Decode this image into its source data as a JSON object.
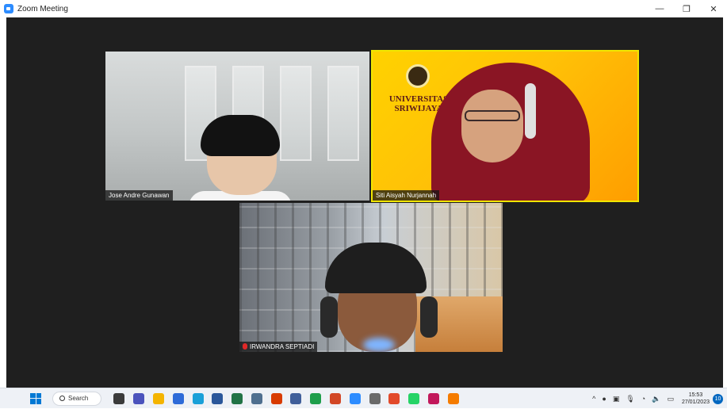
{
  "window": {
    "title": "Zoom Meeting",
    "controls": {
      "minimize": "—",
      "restore": "❐",
      "close": "✕"
    }
  },
  "participants": [
    {
      "name": "Jose Andre Gunawan",
      "muted": false
    },
    {
      "name": "Siti Aisyah Nurjannah",
      "muted": false,
      "active_speaker": true,
      "background_text": "UNIVERSITAS SRIWIJAYA"
    },
    {
      "name": "IRWANDRA SEPTIADI",
      "muted": true
    }
  ],
  "taskbar": {
    "search_label": "Search",
    "apps": [
      {
        "icon": "task-view-icon",
        "color": "#3b3b3b"
      },
      {
        "icon": "chat-icon",
        "color": "#4b53bc"
      },
      {
        "icon": "file-explorer-icon",
        "color": "#f4b400"
      },
      {
        "icon": "app-blue-icon",
        "color": "#2e6bd8"
      },
      {
        "icon": "notepad-icon",
        "color": "#1aa0d8"
      },
      {
        "icon": "word-icon",
        "color": "#2b579a"
      },
      {
        "icon": "excel-icon",
        "color": "#217346"
      },
      {
        "icon": "app-grey-icon",
        "color": "#4f6f8f"
      },
      {
        "icon": "pdf-icon",
        "color": "#d83b01"
      },
      {
        "icon": "camera-icon",
        "color": "#405f9a"
      },
      {
        "icon": "chrome-icon",
        "color": "#1e9e4b"
      },
      {
        "icon": "powerpoint-icon",
        "color": "#d24726"
      },
      {
        "icon": "zoom-icon",
        "color": "#2d8cff"
      },
      {
        "icon": "pen-icon",
        "color": "#6a6a6a"
      },
      {
        "icon": "chrome-beta-icon",
        "color": "#e24a2b"
      },
      {
        "icon": "whatsapp-icon",
        "color": "#25d366"
      },
      {
        "icon": "snipping-icon",
        "color": "#c2185b"
      },
      {
        "icon": "vlc-icon",
        "color": "#f57c00"
      }
    ],
    "tray": {
      "chevron": "^",
      "clock_time": "15:53",
      "clock_date": "27/01/2023",
      "notifications": "10"
    }
  }
}
